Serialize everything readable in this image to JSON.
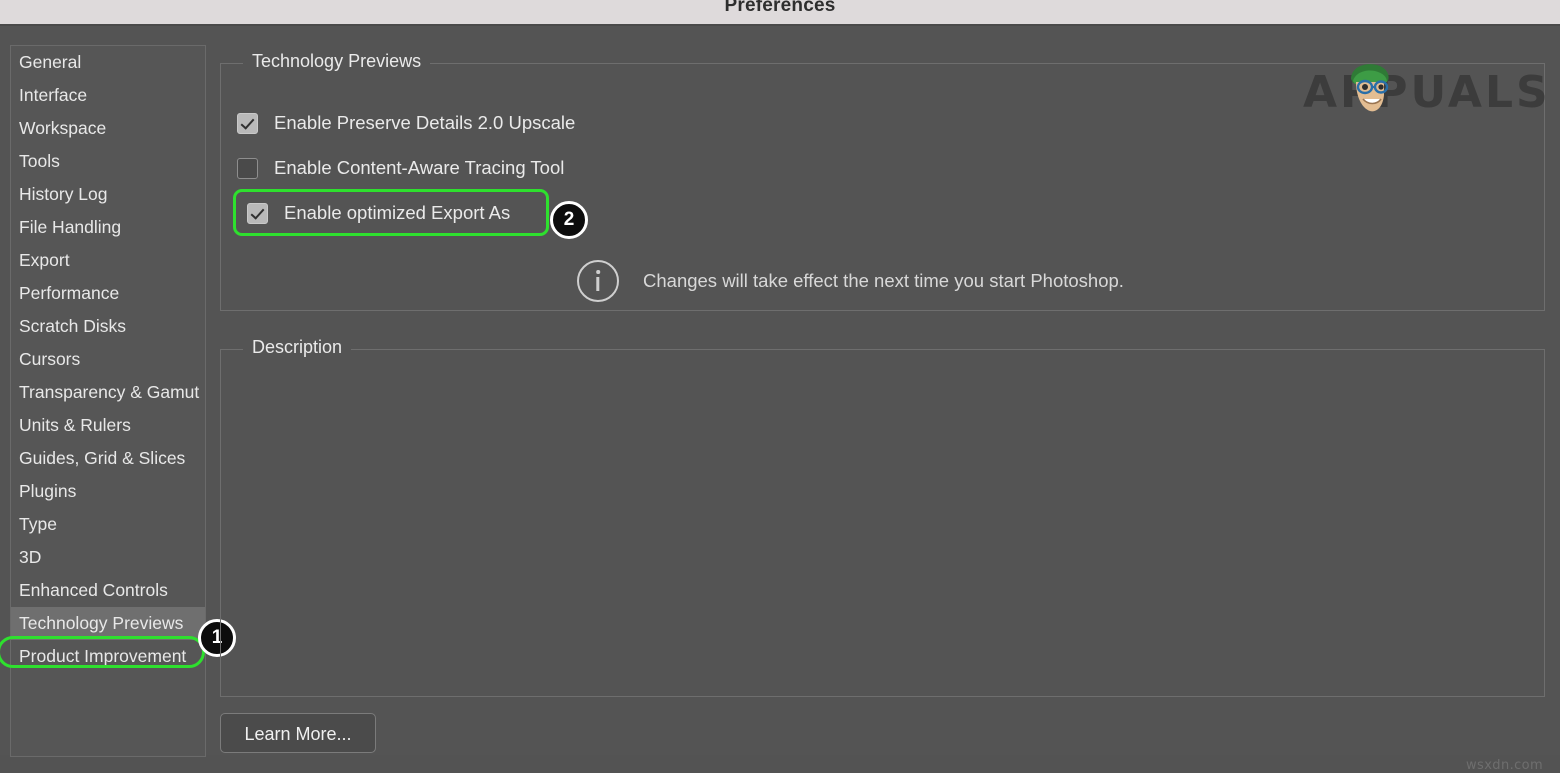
{
  "window": {
    "title": "Preferences"
  },
  "sidebar": {
    "items": [
      {
        "label": "General",
        "selected": false
      },
      {
        "label": "Interface",
        "selected": false
      },
      {
        "label": "Workspace",
        "selected": false
      },
      {
        "label": "Tools",
        "selected": false
      },
      {
        "label": "History Log",
        "selected": false
      },
      {
        "label": "File Handling",
        "selected": false
      },
      {
        "label": "Export",
        "selected": false
      },
      {
        "label": "Performance",
        "selected": false
      },
      {
        "label": "Scratch Disks",
        "selected": false
      },
      {
        "label": "Cursors",
        "selected": false
      },
      {
        "label": "Transparency & Gamut",
        "selected": false
      },
      {
        "label": "Units & Rulers",
        "selected": false
      },
      {
        "label": "Guides, Grid & Slices",
        "selected": false
      },
      {
        "label": "Plugins",
        "selected": false
      },
      {
        "label": "Type",
        "selected": false
      },
      {
        "label": "3D",
        "selected": false
      },
      {
        "label": "Enhanced Controls",
        "selected": false
      },
      {
        "label": "Technology Previews",
        "selected": true
      },
      {
        "label": "Product Improvement",
        "selected": false
      }
    ]
  },
  "tech_previews": {
    "legend": "Technology Previews",
    "checkboxes": [
      {
        "label": "Enable Preserve Details 2.0 Upscale",
        "checked": true
      },
      {
        "label": "Enable Content-Aware Tracing Tool",
        "checked": false
      },
      {
        "label": "Enable optimized Export As",
        "checked": true
      }
    ],
    "info_note": "Changes will take effect the next time you start Photoshop."
  },
  "description": {
    "legend": "Description",
    "body": ""
  },
  "buttons": {
    "learn_more": "Learn More..."
  },
  "callouts": [
    {
      "number": "1",
      "target": "sidebar-item-technology-previews"
    },
    {
      "number": "2",
      "target": "checkbox-enable-optimized-export-as"
    }
  ],
  "annotation_color": "#2ee02e",
  "watermarks": {
    "brand": "APPUALS",
    "site": "wsxdn.com"
  }
}
